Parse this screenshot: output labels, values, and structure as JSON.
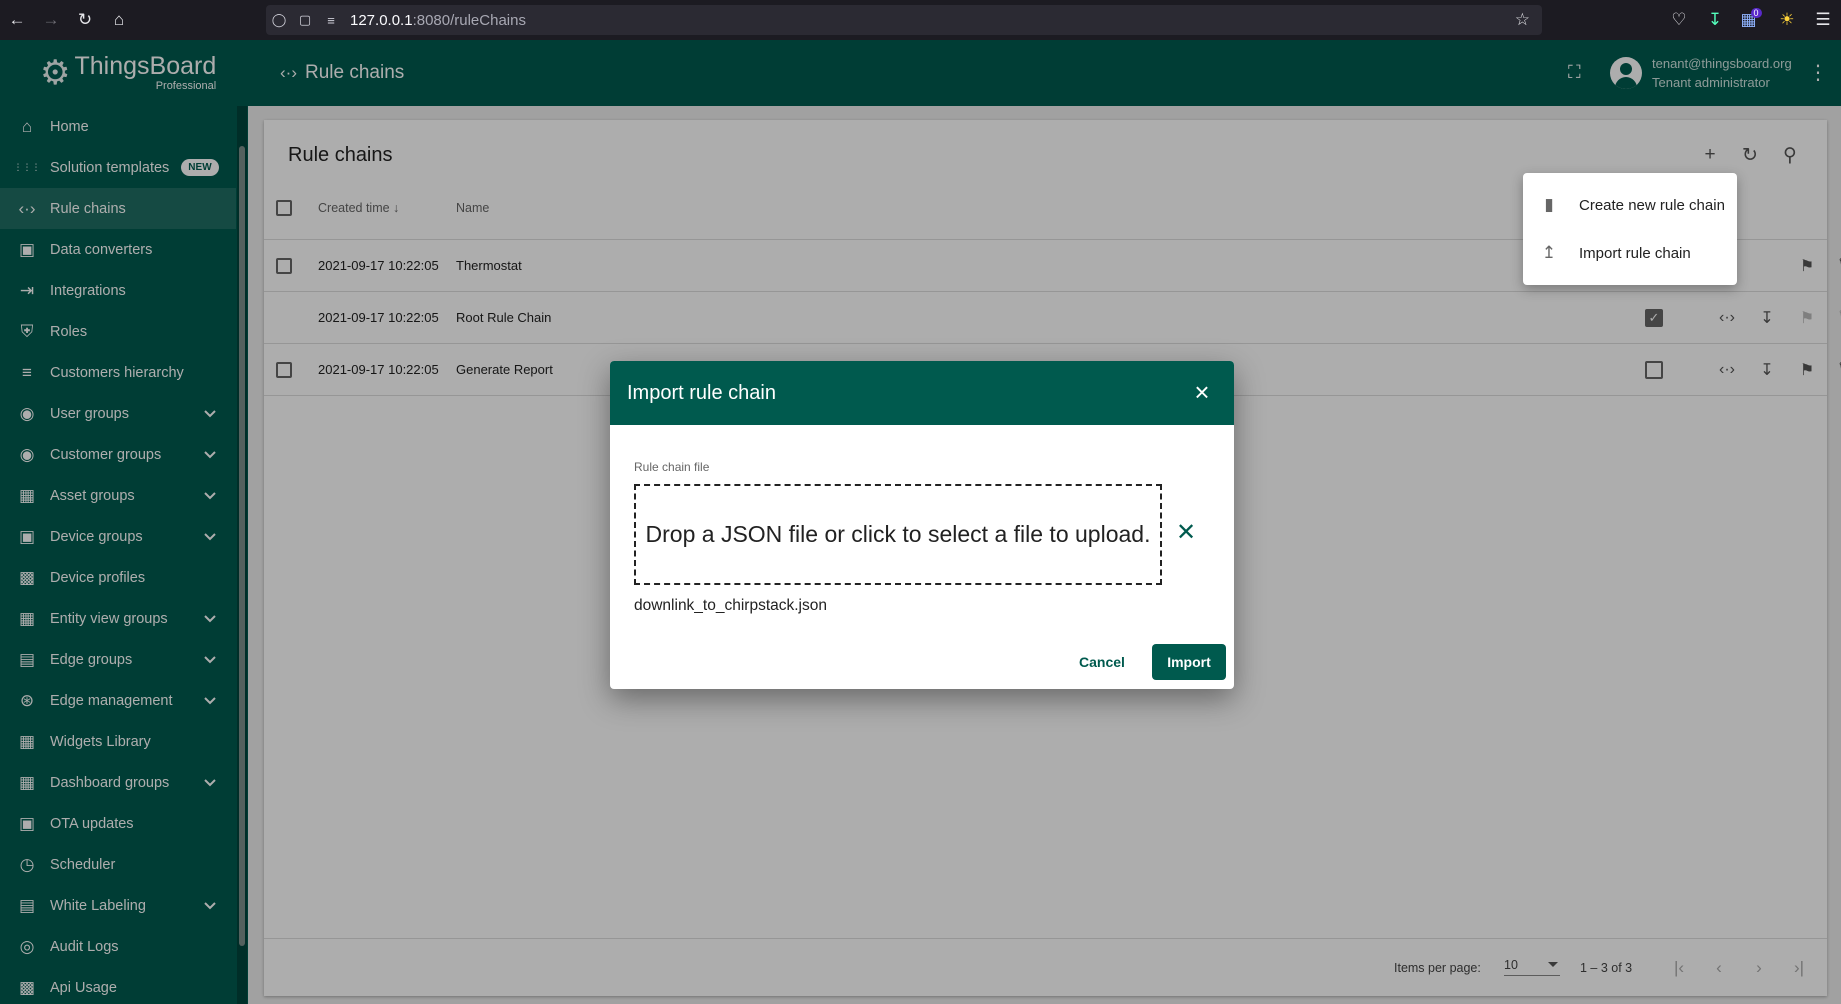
{
  "browser": {
    "url_host": "127.0.0.1",
    "url_rest": ":8080/ruleChains",
    "downloads_badge": "0"
  },
  "app": {
    "logo_main": "ThingsBoard",
    "logo_sub": "Professional",
    "breadcrumb": "Rule chains",
    "user_email": "tenant@thingsboard.org",
    "user_role": "Tenant administrator"
  },
  "sidebar": {
    "items": [
      {
        "label": "Home",
        "icon": "home-icon",
        "expandable": false
      },
      {
        "label": "Solution templates",
        "icon": "apps-grid-icon",
        "expandable": false,
        "badge": "NEW"
      },
      {
        "label": "Rule chains",
        "icon": "settings-ethernet-icon",
        "expandable": false,
        "active": true
      },
      {
        "label": "Data converters",
        "icon": "transform-icon",
        "expandable": false
      },
      {
        "label": "Integrations",
        "icon": "input-icon",
        "expandable": false
      },
      {
        "label": "Roles",
        "icon": "shield-icon",
        "expandable": false
      },
      {
        "label": "Customers hierarchy",
        "icon": "sort-icon",
        "expandable": false
      },
      {
        "label": "User groups",
        "icon": "account-circle-icon",
        "expandable": true
      },
      {
        "label": "Customer groups",
        "icon": "supervisor-account-icon",
        "expandable": true
      },
      {
        "label": "Asset groups",
        "icon": "domain-icon",
        "expandable": true
      },
      {
        "label": "Device groups",
        "icon": "devices-other-icon",
        "expandable": true
      },
      {
        "label": "Device profiles",
        "icon": "device-profile-icon",
        "expandable": false
      },
      {
        "label": "Entity view groups",
        "icon": "view-quilt-icon",
        "expandable": true
      },
      {
        "label": "Edge groups",
        "icon": "router-icon",
        "expandable": true
      },
      {
        "label": "Edge management",
        "icon": "settings-input-antenna-icon",
        "expandable": true
      },
      {
        "label": "Widgets Library",
        "icon": "widgets-icon",
        "expandable": false
      },
      {
        "label": "Dashboard groups",
        "icon": "dashboard-icon",
        "expandable": true
      },
      {
        "label": "OTA updates",
        "icon": "memory-icon",
        "expandable": false
      },
      {
        "label": "Scheduler",
        "icon": "schedule-icon",
        "expandable": false
      },
      {
        "label": "White Labeling",
        "icon": "format-paint-icon",
        "expandable": true
      },
      {
        "label": "Audit Logs",
        "icon": "track-changes-icon",
        "expandable": false
      },
      {
        "label": "Api Usage",
        "icon": "insert-chart-icon",
        "expandable": false
      }
    ]
  },
  "table": {
    "title": "Rule chains",
    "columns": {
      "created_time": "Created time",
      "name": "Name"
    },
    "rows": [
      {
        "created": "2021-09-17 10:22:05",
        "name": "Thermostat",
        "root": false
      },
      {
        "created": "2021-09-17 10:22:05",
        "name": "Root Rule Chain",
        "root": true
      },
      {
        "created": "2021-09-17 10:22:05",
        "name": "Generate Report",
        "root": false
      }
    ]
  },
  "paginator": {
    "items_per_page_label": "Items per page:",
    "items_per_page": "10",
    "range": "1 – 3 of 3"
  },
  "menu": {
    "items": [
      {
        "label": "Create new rule chain",
        "icon": "insert-drive-file-icon"
      },
      {
        "label": "Import rule chain",
        "icon": "file-upload-icon"
      }
    ]
  },
  "dialog": {
    "title": "Import rule chain",
    "field_label": "Rule chain file",
    "dropzone_text": "Drop a JSON file or click to select a file to upload.",
    "file_name": "downlink_to_chirpstack.json",
    "cancel_label": "Cancel",
    "import_label": "Import"
  },
  "colors": {
    "primary": "#005a4e",
    "browser_chrome": "#1c1b22"
  }
}
